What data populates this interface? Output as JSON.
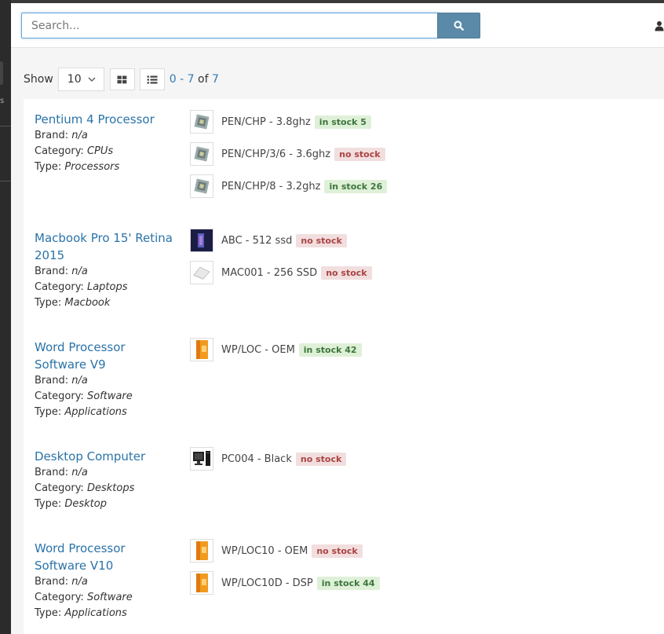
{
  "search": {
    "placeholder": "Search..."
  },
  "toolbar": {
    "show_label": "Show",
    "page_size": "10",
    "range_start": "0",
    "range_sep": " - ",
    "range_end": "7",
    "range_of": " of ",
    "range_total": "7"
  },
  "labels": {
    "brand": "Brand: ",
    "category": "Category: ",
    "type": "Type: "
  },
  "products": [
    {
      "title": "Pentium 4 Processor",
      "brand": "n/a",
      "category": "CPUs",
      "type": "Processors",
      "variants": [
        {
          "label": "PEN/CHP - 3.8ghz",
          "stock": "in stock 5",
          "status": "in",
          "icon": "cpu-chip-icon"
        },
        {
          "label": "PEN/CHP/3/6 - 3.6ghz",
          "stock": "no stock",
          "status": "out",
          "icon": "cpu-chip-icon"
        },
        {
          "label": "PEN/CHP/8 - 3.2ghz",
          "stock": "in stock 26",
          "status": "in",
          "icon": "cpu-chip-icon"
        }
      ]
    },
    {
      "title": "Macbook Pro 15' Retina 2015",
      "brand": "n/a",
      "category": "Laptops",
      "type": "Macbook",
      "variants": [
        {
          "label": "ABC - 512 ssd",
          "stock": "no stock",
          "status": "out",
          "icon": "laptop-screen-icon"
        },
        {
          "label": "MAC001 - 256 SSD",
          "stock": "no stock",
          "status": "out",
          "icon": "laptop-icon"
        }
      ]
    },
    {
      "title": "Word Processor Software V9",
      "brand": "n/a",
      "category": "Software",
      "type": "Applications",
      "variants": [
        {
          "label": "WP/LOC - OEM",
          "stock": "in stock 42",
          "status": "in",
          "icon": "software-box-icon"
        }
      ]
    },
    {
      "title": "Desktop Computer",
      "brand": "n/a",
      "category": "Desktops",
      "type": "Desktop",
      "variants": [
        {
          "label": "PC004 - Black",
          "stock": "no stock",
          "status": "out",
          "icon": "desktop-computer-icon"
        }
      ]
    },
    {
      "title": "Word Processor Software V10",
      "brand": "n/a",
      "category": "Software",
      "type": "Applications",
      "variants": [
        {
          "label": "WP/LOC10 - OEM",
          "stock": "no stock",
          "status": "out",
          "icon": "software-box-icon"
        },
        {
          "label": "WP/LOC10D - DSP",
          "stock": "in stock 44",
          "status": "in",
          "icon": "software-box-icon"
        }
      ]
    }
  ],
  "colors": {
    "accent": "#5a8aa8",
    "link": "#2a73a8",
    "in_stock_bg": "#dff0d8",
    "out_stock_bg": "#f2dede"
  }
}
